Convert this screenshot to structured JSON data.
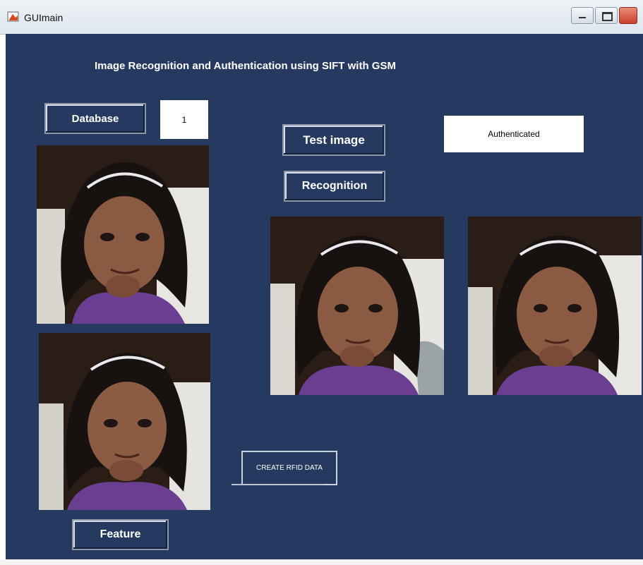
{
  "window": {
    "title": "GUImain",
    "icon": "matlab-figure-icon",
    "controls": [
      "minimize-icon",
      "maximize-icon",
      "close-icon"
    ]
  },
  "heading": "Image Recognition and Authentication using SIFT with GSM",
  "buttons": {
    "database": "Database",
    "test_image": "Test image",
    "recognition": "Recognition",
    "create_rfid": "CREATE RFID DATA",
    "feature": "Feature"
  },
  "fields": {
    "database_index": "1",
    "status": "Authenticated"
  },
  "images": [
    "database-image",
    "feature-image",
    "test-image",
    "recognized-image"
  ],
  "colors": {
    "background": "#253a5e",
    "text": "#ffffff",
    "field": "#ffffff"
  }
}
